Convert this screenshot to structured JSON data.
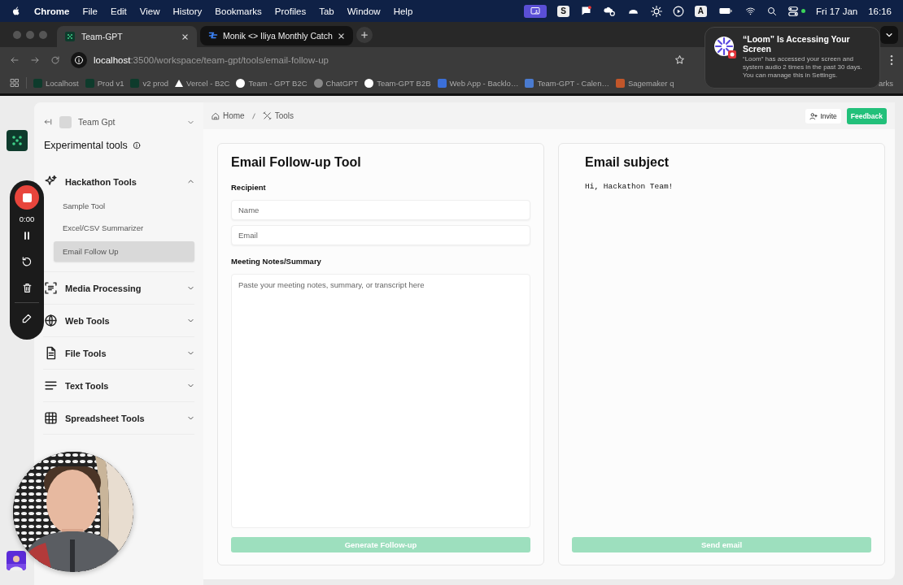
{
  "menu_bar": {
    "app": "Chrome",
    "menus": [
      "File",
      "Edit",
      "View",
      "History",
      "Bookmarks",
      "Profiles",
      "Tab",
      "Window",
      "Help"
    ],
    "letter_badges": [
      "S",
      "A"
    ],
    "date": "Fri 17 Jan",
    "time": "16:16"
  },
  "browser": {
    "tabs": [
      {
        "title": "Team-GPT",
        "selected": true
      },
      {
        "title": "Monik <> Iliya Monthly Catch",
        "selected": false
      }
    ],
    "address": {
      "host": "localhost",
      "path": ":3500/workspace/team-gpt/tools/email-follow-up"
    },
    "bookmarks": [
      "Localhost",
      "Prod v1",
      "v2 prod",
      "Vercel - B2C",
      "Team - GPT B2C",
      "ChatGPT",
      "Team-GPT B2B",
      "Web App - Backlo…",
      "Team-GPT - Calen…",
      "Sagemaker q"
    ],
    "bookmarks_end": "arks"
  },
  "notification": {
    "title": "“Loom” Is Accessing Your Screen",
    "body": "“Loom” has accessed your screen and system audio 2 times in the past 30 days. You can manage this in Settings."
  },
  "recorder": {
    "timer": "0:00"
  },
  "sidebar": {
    "workspace": "Team Gpt",
    "heading": "Experimental tools",
    "groups": [
      {
        "label": "Hackathon Tools",
        "expanded": true,
        "items": [
          {
            "label": "Sample Tool",
            "selected": false
          },
          {
            "label": "Excel/CSV Summarizer",
            "selected": false
          },
          {
            "label": "Email Follow Up",
            "selected": true
          }
        ]
      },
      {
        "label": "Media Processing",
        "expanded": false
      },
      {
        "label": "Web Tools",
        "expanded": false
      },
      {
        "label": "File Tools",
        "expanded": false
      },
      {
        "label": "Text Tools",
        "expanded": false
      },
      {
        "label": "Spreadsheet Tools",
        "expanded": false
      }
    ]
  },
  "header": {
    "breadcrumb": [
      "Home",
      "Tools"
    ],
    "invite": "Invite",
    "feedback": "Feedback"
  },
  "form": {
    "title": "Email Follow-up Tool",
    "recipient_label": "Recipient",
    "name_placeholder": "Name",
    "email_placeholder": "Email",
    "notes_label": "Meeting Notes/Summary",
    "notes_placeholder": "Paste your meeting notes, summary, or transcript here",
    "generate_button": {
      "label": "Generate Follow-up",
      "disabled": true
    }
  },
  "preview": {
    "heading": "Email subject",
    "body": "Hi, Hackathon Team!",
    "send_button": {
      "label": "Send email",
      "disabled": true
    }
  }
}
